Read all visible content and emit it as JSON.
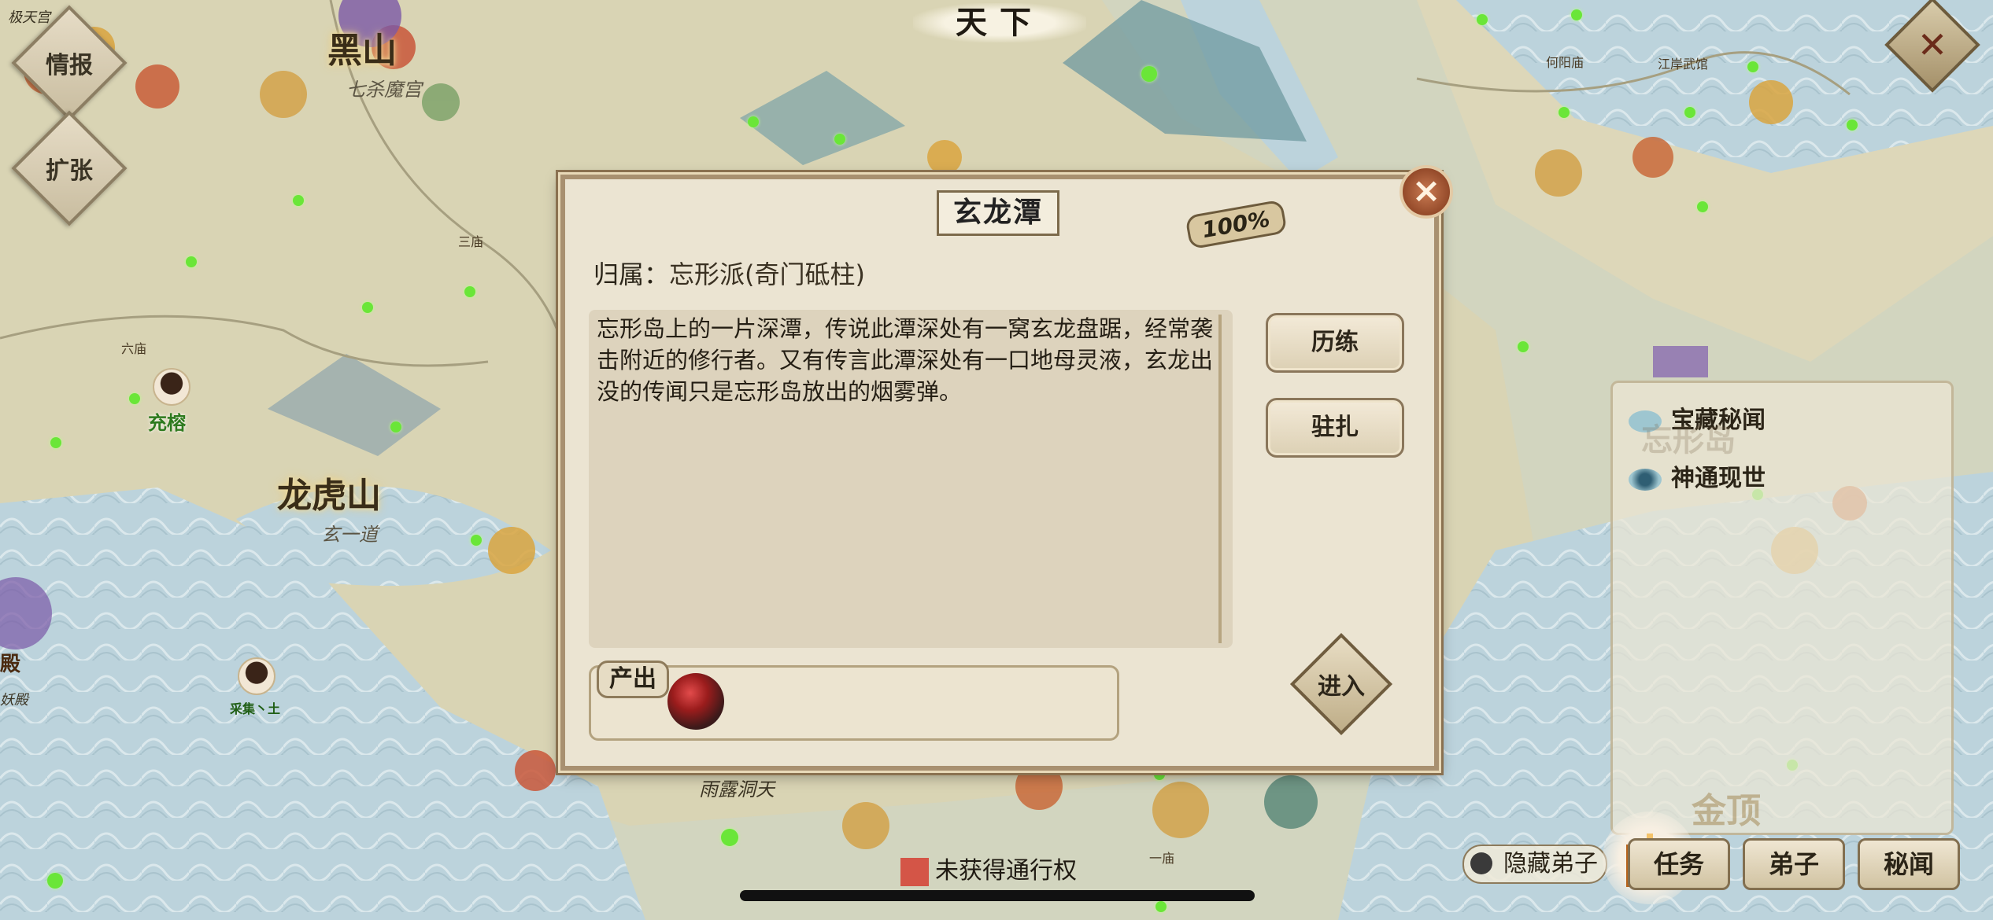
{
  "top_title": "天下",
  "left_buttons": {
    "intel": "情报",
    "expand": "扩张"
  },
  "map_labels": {
    "heishan": "黑山",
    "heishan_sub": "七杀魔宫",
    "longhushan": "龙虎山",
    "longhushan_sub": "玄一道",
    "chongrong": "充榕",
    "caiji": "采集丶土",
    "tiny_a": "极天宫",
    "tiny_b": "三庙",
    "tiny_c": "六庙",
    "tiny_d": "何阳庙",
    "tiny_e": "江岸武馆",
    "tiny_f": "一庙",
    "dian": "殿",
    "yaodian": "妖殿",
    "bottom_place": "雨露洞天"
  },
  "dialog": {
    "title": "玄龙潭",
    "progress": "100%",
    "affiliation_label": "归属：",
    "affiliation_value": "忘形派(奇门砥柱)",
    "description": "忘形岛上的一片深潭，传说此潭深处有一窝玄龙盘踞，经常袭击附近的修行者。又有传言此潭深处有一口地母灵液，玄龙出没的传闻只是忘形岛放出的烟雾弹。",
    "buttons": {
      "train": "历练",
      "garrison": "驻扎",
      "enter": "进入"
    },
    "produce_label": "产出",
    "produce_item_icon": "red-ore-icon",
    "close_icon": "close-icon"
  },
  "right_panel": {
    "events": [
      {
        "label": "宝藏秘闻",
        "icon": "treasure-icon"
      },
      {
        "label": "神通现世",
        "icon": "vortex-icon"
      }
    ],
    "map_name_top": "忘形岛",
    "map_name_bottom": "金顶"
  },
  "bottom": {
    "pass_status": "未获得通行权",
    "hide_disciples": "隐藏弟子",
    "tabs": [
      "任务",
      "弟子",
      "秘闻"
    ]
  },
  "colors": {
    "dialog_bg": "#ebe4d2",
    "frame": "#a89070",
    "accent_red": "#d45547",
    "marker_green": "#6ae638"
  }
}
